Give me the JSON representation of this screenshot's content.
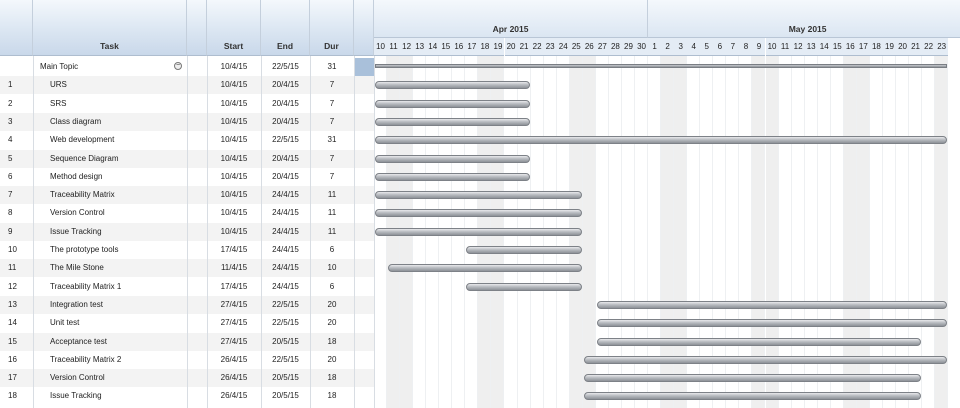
{
  "columns": {
    "task": "Task",
    "start": "Start",
    "end": "End",
    "dur": "Dur"
  },
  "timeline": {
    "months": [
      {
        "label": "Apr 2015",
        "first_day": 10,
        "last_day": 30
      },
      {
        "label": "May 2015",
        "first_day": 1,
        "last_day": 23
      }
    ],
    "weekend_apr": [
      11,
      12,
      18,
      19,
      25,
      26
    ],
    "weekend_may": [
      2,
      3,
      9,
      10,
      16,
      17,
      23
    ]
  },
  "tasks": [
    {
      "id": "",
      "name": "Main Topic",
      "start": "10/4/15",
      "end": "22/5/15",
      "dur": "31",
      "summary": true,
      "s": 0,
      "e": 43
    },
    {
      "id": "1",
      "name": "URS",
      "start": "10/4/15",
      "end": "20/4/15",
      "dur": "7",
      "s": 0,
      "e": 11
    },
    {
      "id": "2",
      "name": "SRS",
      "start": "10/4/15",
      "end": "20/4/15",
      "dur": "7",
      "s": 0,
      "e": 11
    },
    {
      "id": "3",
      "name": "Class diagram",
      "start": "10/4/15",
      "end": "20/4/15",
      "dur": "7",
      "s": 0,
      "e": 11
    },
    {
      "id": "4",
      "name": "Web development",
      "start": "10/4/15",
      "end": "22/5/15",
      "dur": "31",
      "s": 0,
      "e": 43
    },
    {
      "id": "5",
      "name": "Sequence Diagram",
      "start": "10/4/15",
      "end": "20/4/15",
      "dur": "7",
      "s": 0,
      "e": 11
    },
    {
      "id": "6",
      "name": "Method design",
      "start": "10/4/15",
      "end": "20/4/15",
      "dur": "7",
      "s": 0,
      "e": 11
    },
    {
      "id": "7",
      "name": "Traceability Matrix",
      "start": "10/4/15",
      "end": "24/4/15",
      "dur": "11",
      "s": 0,
      "e": 15
    },
    {
      "id": "8",
      "name": "Version Control",
      "start": "10/4/15",
      "end": "24/4/15",
      "dur": "11",
      "s": 0,
      "e": 15
    },
    {
      "id": "9",
      "name": "Issue Tracking",
      "start": "10/4/15",
      "end": "24/4/15",
      "dur": "11",
      "s": 0,
      "e": 15
    },
    {
      "id": "10",
      "name": "The prototype tools",
      "start": "17/4/15",
      "end": "24/4/15",
      "dur": "6",
      "s": 7,
      "e": 15
    },
    {
      "id": "11",
      "name": "The Mile Stone",
      "start": "11/4/15",
      "end": "24/4/15",
      "dur": "10",
      "s": 1,
      "e": 15
    },
    {
      "id": "12",
      "name": "Traceability Matrix 1",
      "start": "17/4/15",
      "end": "24/4/15",
      "dur": "6",
      "s": 7,
      "e": 15
    },
    {
      "id": "13",
      "name": "Integration test",
      "start": "27/4/15",
      "end": "22/5/15",
      "dur": "20",
      "s": 17,
      "e": 43
    },
    {
      "id": "14",
      "name": "Unit test",
      "start": "27/4/15",
      "end": "22/5/15",
      "dur": "20",
      "s": 17,
      "e": 43
    },
    {
      "id": "15",
      "name": "Acceptance test",
      "start": "27/4/15",
      "end": "20/5/15",
      "dur": "18",
      "s": 17,
      "e": 41
    },
    {
      "id": "16",
      "name": "Traceability Matrix 2",
      "start": "26/4/15",
      "end": "22/5/15",
      "dur": "20",
      "s": 16,
      "e": 43
    },
    {
      "id": "17",
      "name": "Version Control",
      "start": "26/4/15",
      "end": "20/5/15",
      "dur": "18",
      "s": 16,
      "e": 41
    },
    {
      "id": "18",
      "name": "Issue Tracking",
      "start": "26/4/15",
      "end": "20/5/15",
      "dur": "18",
      "s": 16,
      "e": 41
    }
  ]
}
